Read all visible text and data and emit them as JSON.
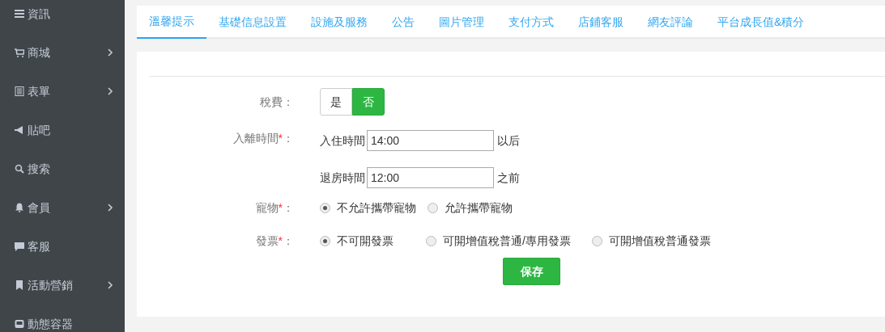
{
  "sidebar": {
    "items": [
      {
        "label": "資訊",
        "has_submenu": false
      },
      {
        "label": "商城",
        "has_submenu": true
      },
      {
        "label": "表單",
        "has_submenu": true
      },
      {
        "label": "貼吧",
        "has_submenu": false
      },
      {
        "label": "搜索",
        "has_submenu": false
      },
      {
        "label": "會員",
        "has_submenu": true
      },
      {
        "label": "客服",
        "has_submenu": false
      },
      {
        "label": "活動營銷",
        "has_submenu": true
      },
      {
        "label": "動態容器",
        "has_submenu": false
      }
    ]
  },
  "tabs": [
    {
      "label": "溫馨提示",
      "selected": true
    },
    {
      "label": "基礎信息設置",
      "selected": false
    },
    {
      "label": "設施及服務",
      "selected": false
    },
    {
      "label": "公告",
      "selected": false
    },
    {
      "label": "圖片管理",
      "selected": false
    },
    {
      "label": "支付方式",
      "selected": false
    },
    {
      "label": "店鋪客服",
      "selected": false
    },
    {
      "label": "網友評論",
      "selected": false
    },
    {
      "label": "平台成長值&積分",
      "selected": false
    }
  ],
  "form": {
    "rows": [
      {
        "kind": "toggle",
        "label": "稅費",
        "colon": "：",
        "options": [
          {
            "label": "是",
            "selected": false
          },
          {
            "label": "否",
            "selected": true
          }
        ]
      },
      {
        "kind": "times",
        "label": "入離時間",
        "required_mark": "*",
        "colon": "：",
        "fields": [
          {
            "prefix": "入住時間",
            "value": "14:00",
            "suffix": "以后"
          },
          {
            "prefix": "退房時間",
            "value": "12:00",
            "suffix": "之前"
          }
        ]
      },
      {
        "kind": "radio",
        "label": "寵物",
        "required_mark": "*",
        "colon": "：",
        "options": [
          {
            "label": "不允許攜帶寵物",
            "selected": true
          },
          {
            "label": "允許攜帶寵物",
            "selected": false
          }
        ]
      },
      {
        "kind": "radio",
        "label": "發票",
        "required_mark": "*",
        "colon": "：",
        "options": [
          {
            "label": "不可開發票",
            "selected": true
          },
          {
            "label": "可開增值稅普通/專用發票",
            "selected": false
          },
          {
            "label": "可開增值稅普通發票",
            "selected": false
          }
        ]
      }
    ],
    "save_button": "保存"
  }
}
